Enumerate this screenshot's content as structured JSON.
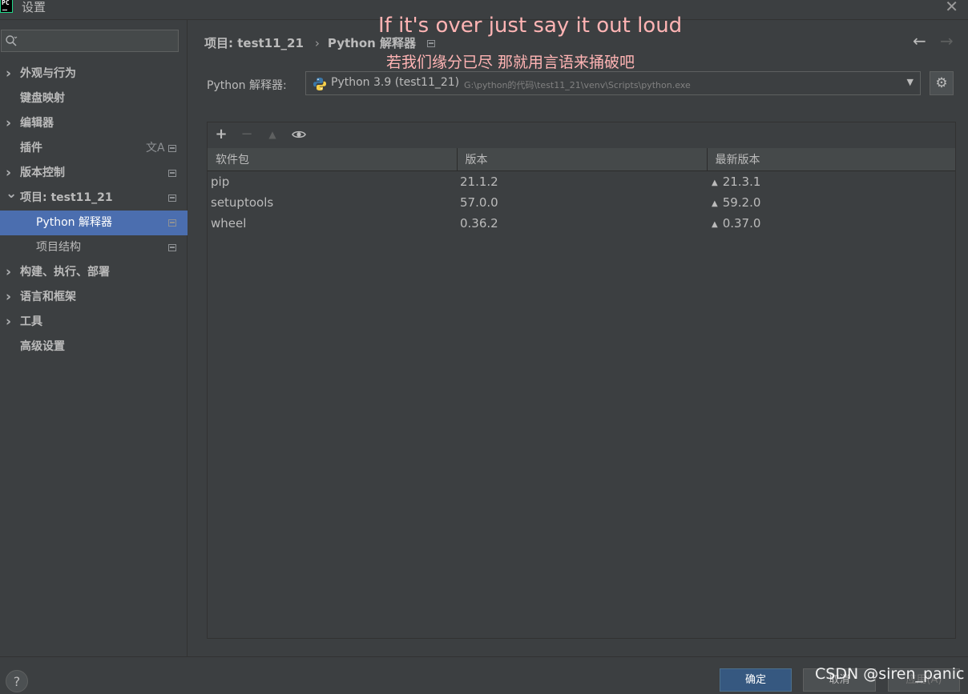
{
  "window": {
    "title": "设置",
    "logo_text": "PC",
    "close_glyph": "✕"
  },
  "overlay": {
    "caption_en": "If it's over just say it out loud",
    "caption_zh": "若我们缘分已尽 那就用言语来捅破吧",
    "watermark": "CSDN @siren_panic"
  },
  "sidebar": {
    "search": {
      "value": "",
      "placeholder": ""
    },
    "items": [
      {
        "label": "外观与行为",
        "expandable": true,
        "expanded": false
      },
      {
        "label": "键盘映射",
        "expandable": false
      },
      {
        "label": "编辑器",
        "expandable": true,
        "expanded": false
      },
      {
        "label": "插件",
        "expandable": false,
        "translate_icon": "文A"
      },
      {
        "label": "版本控制",
        "expandable": true,
        "expanded": false
      },
      {
        "label": "项目: test11_21",
        "expandable": true,
        "expanded": true
      },
      {
        "label": "Python 解释器",
        "child": true,
        "selected": true
      },
      {
        "label": "项目结构",
        "child": true
      },
      {
        "label": "构建、执行、部署",
        "expandable": true,
        "expanded": false
      },
      {
        "label": "语言和框架",
        "expandable": true,
        "expanded": false
      },
      {
        "label": "工具",
        "expandable": true,
        "expanded": false
      },
      {
        "label": "高级设置",
        "expandable": false
      }
    ]
  },
  "main": {
    "breadcrumb": {
      "project": "项目: test11_21",
      "separator": "›",
      "current": "Python 解释器"
    },
    "back_glyph": "←",
    "forward_glyph": "→",
    "interpreter": {
      "label": "Python 解释器:",
      "name": "Python 3.9 (test11_21)",
      "path": "G:\\python的代码\\test11_21\\venv\\Scripts\\python.exe",
      "dropdown_glyph": "▼",
      "gear_glyph": "⚙"
    },
    "toolbar": {
      "add": "+",
      "remove": "−",
      "upgrade": "▲",
      "eye": "👁"
    },
    "table": {
      "columns": [
        "软件包",
        "版本",
        "最新版本"
      ],
      "upgrade_glyph": "▲",
      "rows": [
        {
          "package": "pip",
          "version": "21.1.2",
          "latest": "21.3.1"
        },
        {
          "package": "setuptools",
          "version": "57.0.0",
          "latest": "59.2.0"
        },
        {
          "package": "wheel",
          "version": "0.36.2",
          "latest": "0.37.0"
        }
      ]
    }
  },
  "footer": {
    "help": "?",
    "ok": "确定",
    "cancel": "取消",
    "apply": "应用(A)"
  },
  "colors": {
    "background": "#3c3f41",
    "selected": "#4b6eaf",
    "primary_button": "#365880",
    "caption": "#ffb4b4"
  }
}
